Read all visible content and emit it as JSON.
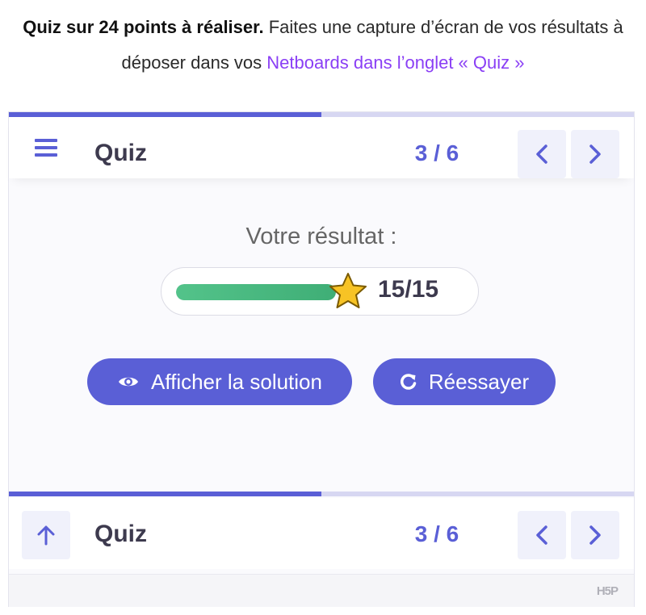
{
  "intro": {
    "bold": "Quiz sur 24 points à réaliser.",
    "text": " Faites une capture d’écran de vos résultats à déposer dans vos ",
    "link": "Netboards dans l’onglet « Quiz »"
  },
  "header": {
    "title": "Quiz",
    "counter": "3 / 6",
    "progress_fraction": 0.5
  },
  "result": {
    "label": "Votre résultat :",
    "score": "15/15",
    "score_fraction": 1.0
  },
  "buttons": {
    "show_solution": "Afficher la solution",
    "retry": "Réessayer"
  },
  "footer_bar": {
    "title": "Quiz",
    "counter": "3 / 6"
  },
  "branding": {
    "logo": "H5P"
  },
  "colors": {
    "accent": "#5a5fd6",
    "progress_track": "#d7d7f2",
    "score_fill": "#53c38a",
    "link": "#8a3ff5",
    "star": "#f7c325"
  },
  "icons": {
    "menu": "hamburger-icon",
    "prev": "chevron-left-icon",
    "next": "chevron-right-icon",
    "up": "arrow-up-icon",
    "eye": "eye-icon",
    "retry": "refresh-icon",
    "star": "star-icon"
  }
}
